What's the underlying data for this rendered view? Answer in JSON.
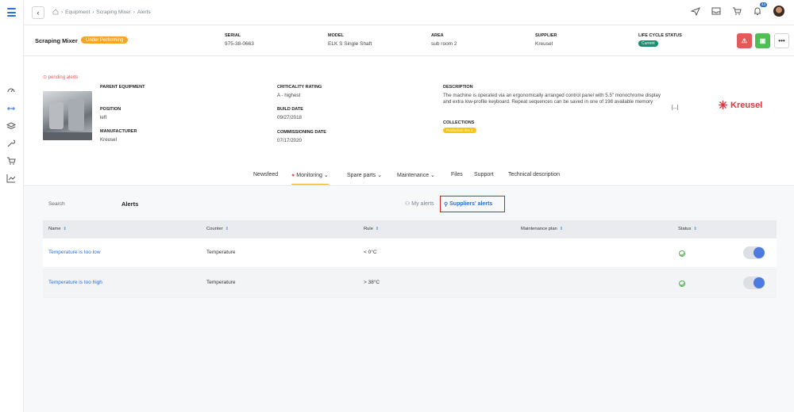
{
  "topbar": {
    "breadcrumb": [
      "Equipment",
      "Scraping Mixer",
      "Alerts"
    ],
    "notification_count": "44",
    "icons": [
      "back-icon",
      "home-icon",
      "send-icon",
      "inbox-icon",
      "cart-icon",
      "bell-icon"
    ]
  },
  "sidebar": {
    "icons": [
      "menu-icon",
      "gauge-icon",
      "equipment-icon",
      "layers-icon",
      "wrench-icon",
      "cart-icon",
      "chart-icon"
    ]
  },
  "equipment": {
    "name": "Scraping Mixer",
    "status": "Under Performing",
    "serial_label": "SERIAL",
    "serial": "975-38-0663",
    "model_label": "MODEL",
    "model": "ELK S Single Shaft",
    "area_label": "AREA",
    "area": "sub room 2",
    "supplier_label": "SUPPLIER",
    "supplier": "Kreusel",
    "lifecycle_label": "LIFE CYCLE STATUS",
    "lifecycle": "Current",
    "actions": [
      "alert-button",
      "calendar-button",
      "more-button"
    ],
    "more_label": "•••"
  },
  "detail": {
    "pending_alerts": "pending alerts",
    "parent_label": "PARENT EQUIPMENT",
    "parent": "",
    "position_label": "POSITION",
    "position": "left",
    "manufacturer_label": "MANUFACTURER",
    "manufacturer": "Kreusel",
    "criticality_label": "CRITICALITY RATING",
    "criticality": "A - highest",
    "build_label": "BUILD DATE",
    "build": "09/27/2018",
    "commissioning_label": "COMMISSIONING DATE",
    "commissioning": "07/17/2020",
    "description_label": "DESCRIPTION",
    "description": "The machine is operated via an ergonomically arranged control panel with 5.5\" monochrome display and extra low-profile keyboard. Repeat sequences can be saved in one of 198 available memory",
    "more_link": "[...]",
    "collections_label": "COLLECTIONS",
    "collection": "Production line 1",
    "brand": "Kreusel"
  },
  "tabs": [
    "Newsfeed",
    "Monitoring",
    "Spare parts",
    "Maintenance",
    "Files",
    "Support",
    "Technical description"
  ],
  "alerts": {
    "search_placeholder": "Search",
    "title": "Alerts",
    "my_alerts": "My alerts",
    "suppliers_alerts": "Suppliers' alerts",
    "columns": [
      "Name",
      "Counter",
      "Rule",
      "Maintenance plan",
      "Status"
    ],
    "rows": [
      {
        "name": "Temperature is too low",
        "counter": "Temperature",
        "rule": "< 0°C",
        "plan": "",
        "enabled": true
      },
      {
        "name": "Temperature is too high",
        "counter": "Temperature",
        "rule": "> 38°C",
        "plan": "",
        "enabled": true
      }
    ]
  },
  "colors": {
    "accent": "#2f6fd6",
    "warning": "#f5a623",
    "danger": "#e35a5a",
    "success": "#4fbf55",
    "lifecycle": "#1e8a6e"
  }
}
